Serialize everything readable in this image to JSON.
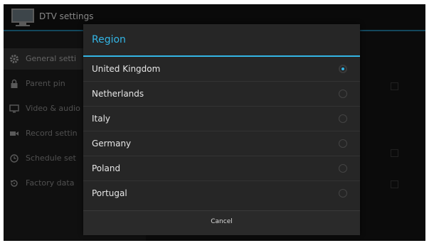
{
  "app": {
    "title": "DTV settings",
    "icon": "tv-app-icon"
  },
  "sidebar": {
    "items": [
      {
        "label": "General setti",
        "icon": "gear-icon",
        "active": true
      },
      {
        "label": "Parent pin",
        "icon": "lock-icon",
        "active": false
      },
      {
        "label": "Video & audio",
        "icon": "monitor-icon",
        "active": false
      },
      {
        "label": "Record settin",
        "icon": "video-camera-icon",
        "active": false
      },
      {
        "label": "Schedule set",
        "icon": "clock-icon",
        "active": false
      },
      {
        "label": "Factory data",
        "icon": "restore-icon",
        "active": false
      }
    ]
  },
  "dialog": {
    "title": "Region",
    "options": [
      {
        "label": "United Kingdom",
        "selected": true
      },
      {
        "label": "Netherlands",
        "selected": false
      },
      {
        "label": "Italy",
        "selected": false
      },
      {
        "label": "Germany",
        "selected": false
      },
      {
        "label": "Poland",
        "selected": false
      },
      {
        "label": "Portugal",
        "selected": false
      }
    ],
    "cancel_label": "Cancel"
  },
  "colors": {
    "accent": "#33b5e5",
    "background": "#0d0d0d",
    "dialog": "#262626"
  }
}
